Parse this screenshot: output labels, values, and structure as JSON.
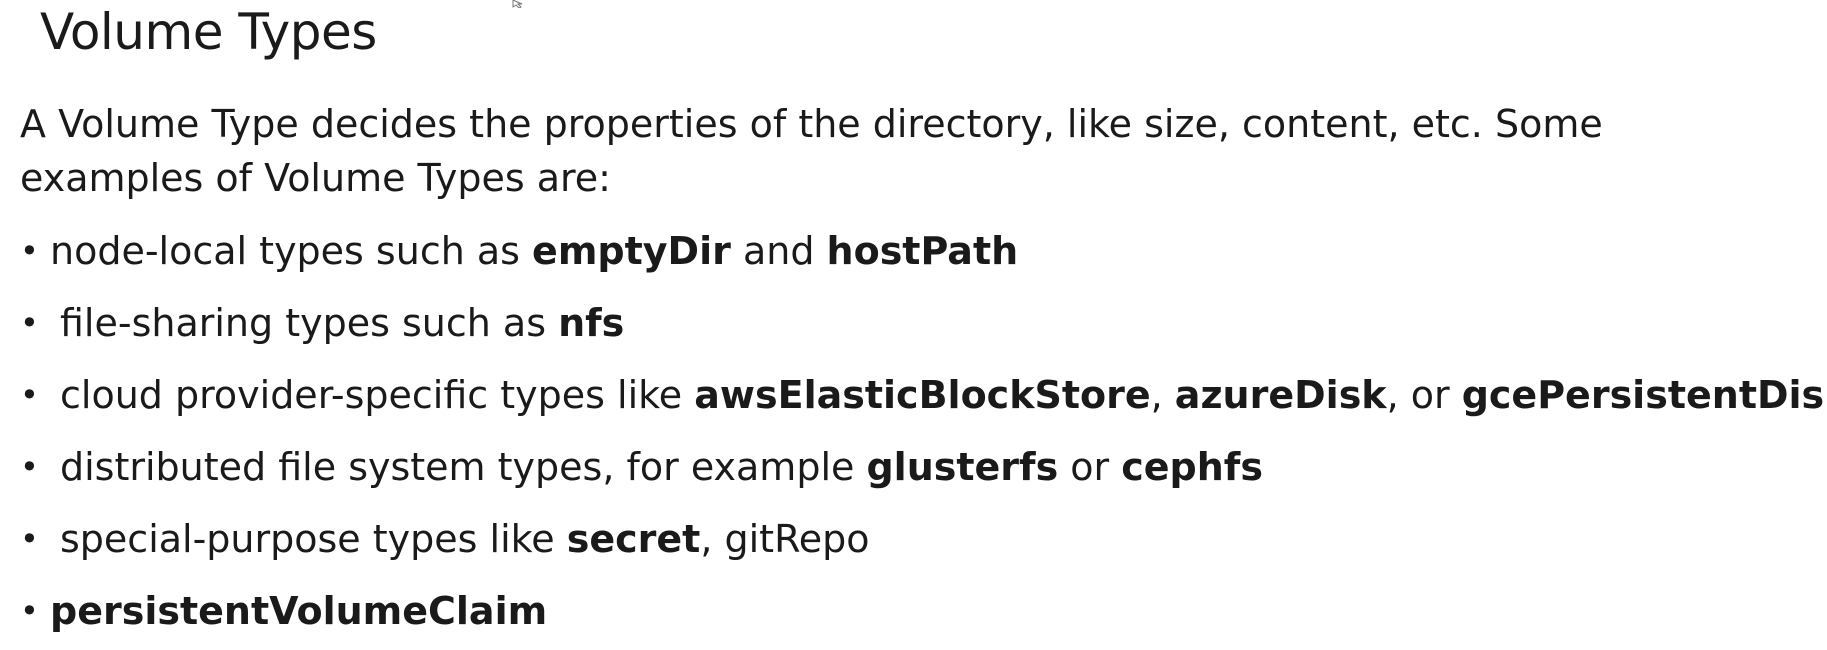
{
  "title": "Volume Types",
  "intro": {
    "line1": "A Volume Type decides the properties of the directory, like size, content, etc. Some",
    "line2": "examples of Volume Types are:"
  },
  "bullet_symbol": "•",
  "items": [
    {
      "p1": "node-local types such as ",
      "b1": "emptyDir",
      "p2": " and ",
      "b2": "hostPath"
    },
    {
      "p1": "file-sharing types such as ",
      "b1": "nfs"
    },
    {
      "p1": "cloud provider-specific types like ",
      "b1": "awsElasticBlockStore",
      "p2": ", ",
      "b2": "azureDisk",
      "p3": ", or ",
      "b3": "gcePersistentDisk"
    },
    {
      "p1": "distributed file system types, for example ",
      "b1": "glusterfs",
      "p2": " or ",
      "b2": "cephfs"
    },
    {
      "p1": "special-purpose types like ",
      "b1": "secret",
      "p2": ", gitRepo"
    },
    {
      "b1": "persistentVolumeClaim"
    }
  ]
}
